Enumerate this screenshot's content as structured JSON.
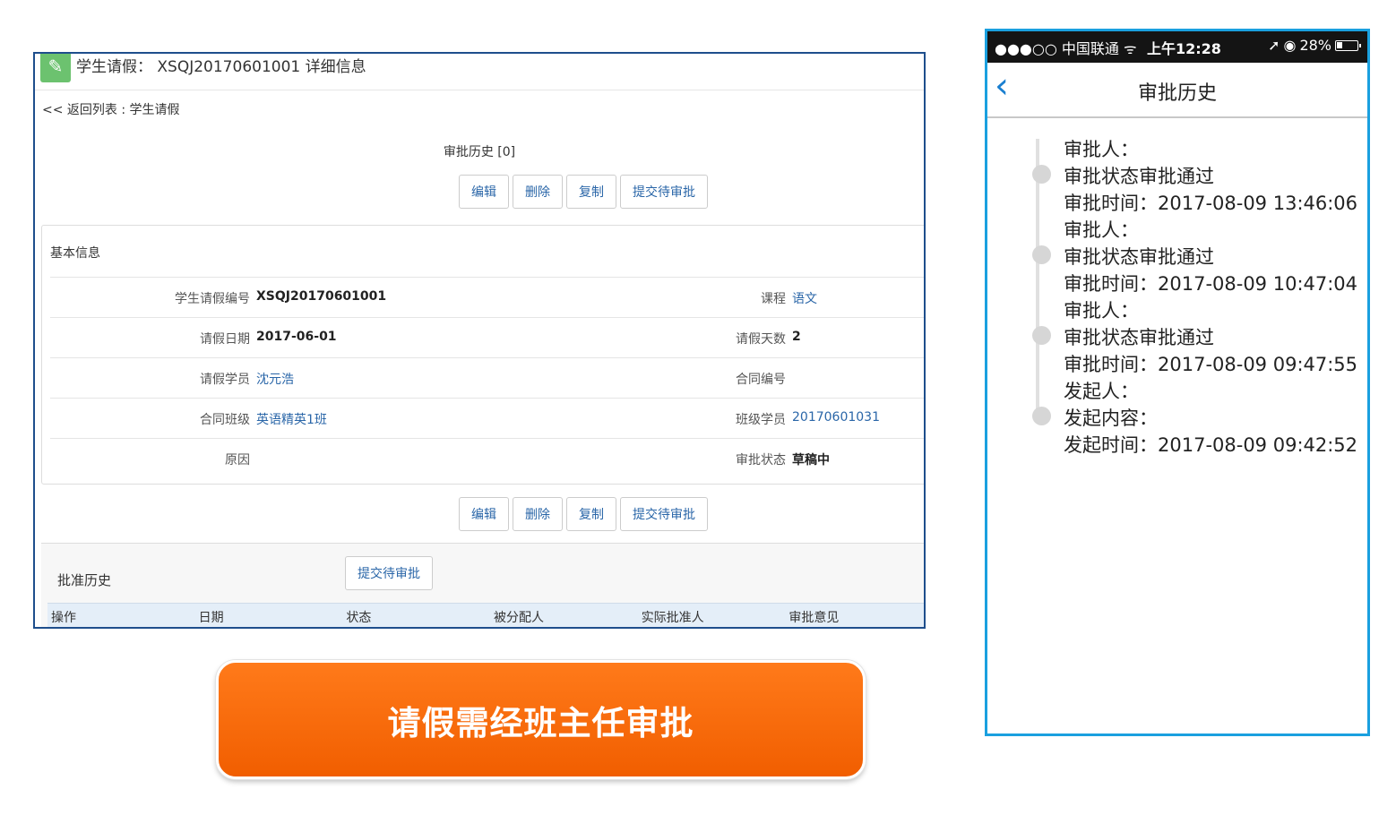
{
  "desktop": {
    "title": "学生请假： XSQJ20170601001  详细信息",
    "back_link": "<< 返回列表 : 学生请假",
    "history_count": "审批历史 [0]",
    "buttons": {
      "edit": "编辑",
      "delete": "删除",
      "copy": "复制",
      "submit": "提交待审批"
    },
    "basic_info_title": "基本信息",
    "rows": [
      {
        "l1": "学生请假编号",
        "v1": "XSQJ20170601001",
        "l2": "课程",
        "v2": "语文"
      },
      {
        "l1": "请假日期",
        "v1": "2017-06-01",
        "l2": "请假天数",
        "v2": "2"
      },
      {
        "l1": "请假学员",
        "v1": "沈元浩",
        "l2": "合同编号",
        "v2": ""
      },
      {
        "l1": "合同班级",
        "v1": "英语精英1班",
        "l2": "班级学员",
        "v2": "20170601031"
      },
      {
        "l1": "原因",
        "v1": "",
        "l2": "审批状态",
        "v2": "草稿中"
      }
    ],
    "approval_title": "批准历史",
    "approval_submit": "提交待审批",
    "table_headers": [
      "操作",
      "日期",
      "状态",
      "被分配人",
      "实际批准人",
      "审批意见"
    ]
  },
  "banner": {
    "text": "请假需经班主任审批"
  },
  "phone": {
    "carrier": "●●●○○ 中国联通 ᯤ",
    "time": "上午12:28",
    "battery": "28%",
    "nav_title": "审批历史",
    "entries": [
      {
        "approver": "审批人：",
        "status": "审批状态审批通过",
        "time": "审批时间：2017-08-09 13:46:06"
      },
      {
        "approver": "审批人：",
        "status": "审批状态审批通过",
        "time": "审批时间：2017-08-09 10:47:04"
      },
      {
        "approver": "审批人：",
        "status": "审批状态审批通过",
        "time": "审批时间：2017-08-09 09:47:55"
      },
      {
        "approver": "发起人：",
        "status": "发起内容：",
        "time": "发起时间：2017-08-09 09:42:52"
      }
    ]
  }
}
